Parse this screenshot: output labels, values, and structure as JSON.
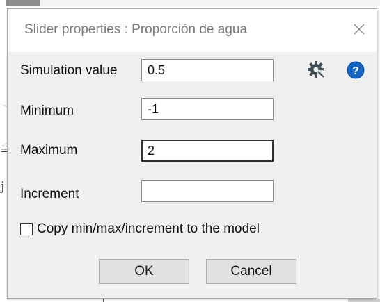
{
  "background": {
    "mark_1": "=",
    "mark_2": "j"
  },
  "dialog": {
    "title": "Slider properties : Proporción de agua",
    "close_icon": "close-icon",
    "fields": {
      "simulation_value": {
        "label": "Simulation value",
        "value": "0.5"
      },
      "minimum": {
        "label": "Minimum",
        "value": "-1"
      },
      "maximum": {
        "label": "Maximum",
        "value": "2"
      },
      "increment": {
        "label": "Increment",
        "value": ""
      }
    },
    "gear_icon": "gear-icon",
    "help_icon": "help-icon",
    "copy_checkbox": {
      "label": "Copy min/max/increment to the model",
      "checked": false
    },
    "buttons": {
      "ok": "OK",
      "cancel": "Cancel"
    },
    "colors": {
      "help_blue": "#1565c0",
      "dialog_bg": "#f0f0f0"
    }
  }
}
